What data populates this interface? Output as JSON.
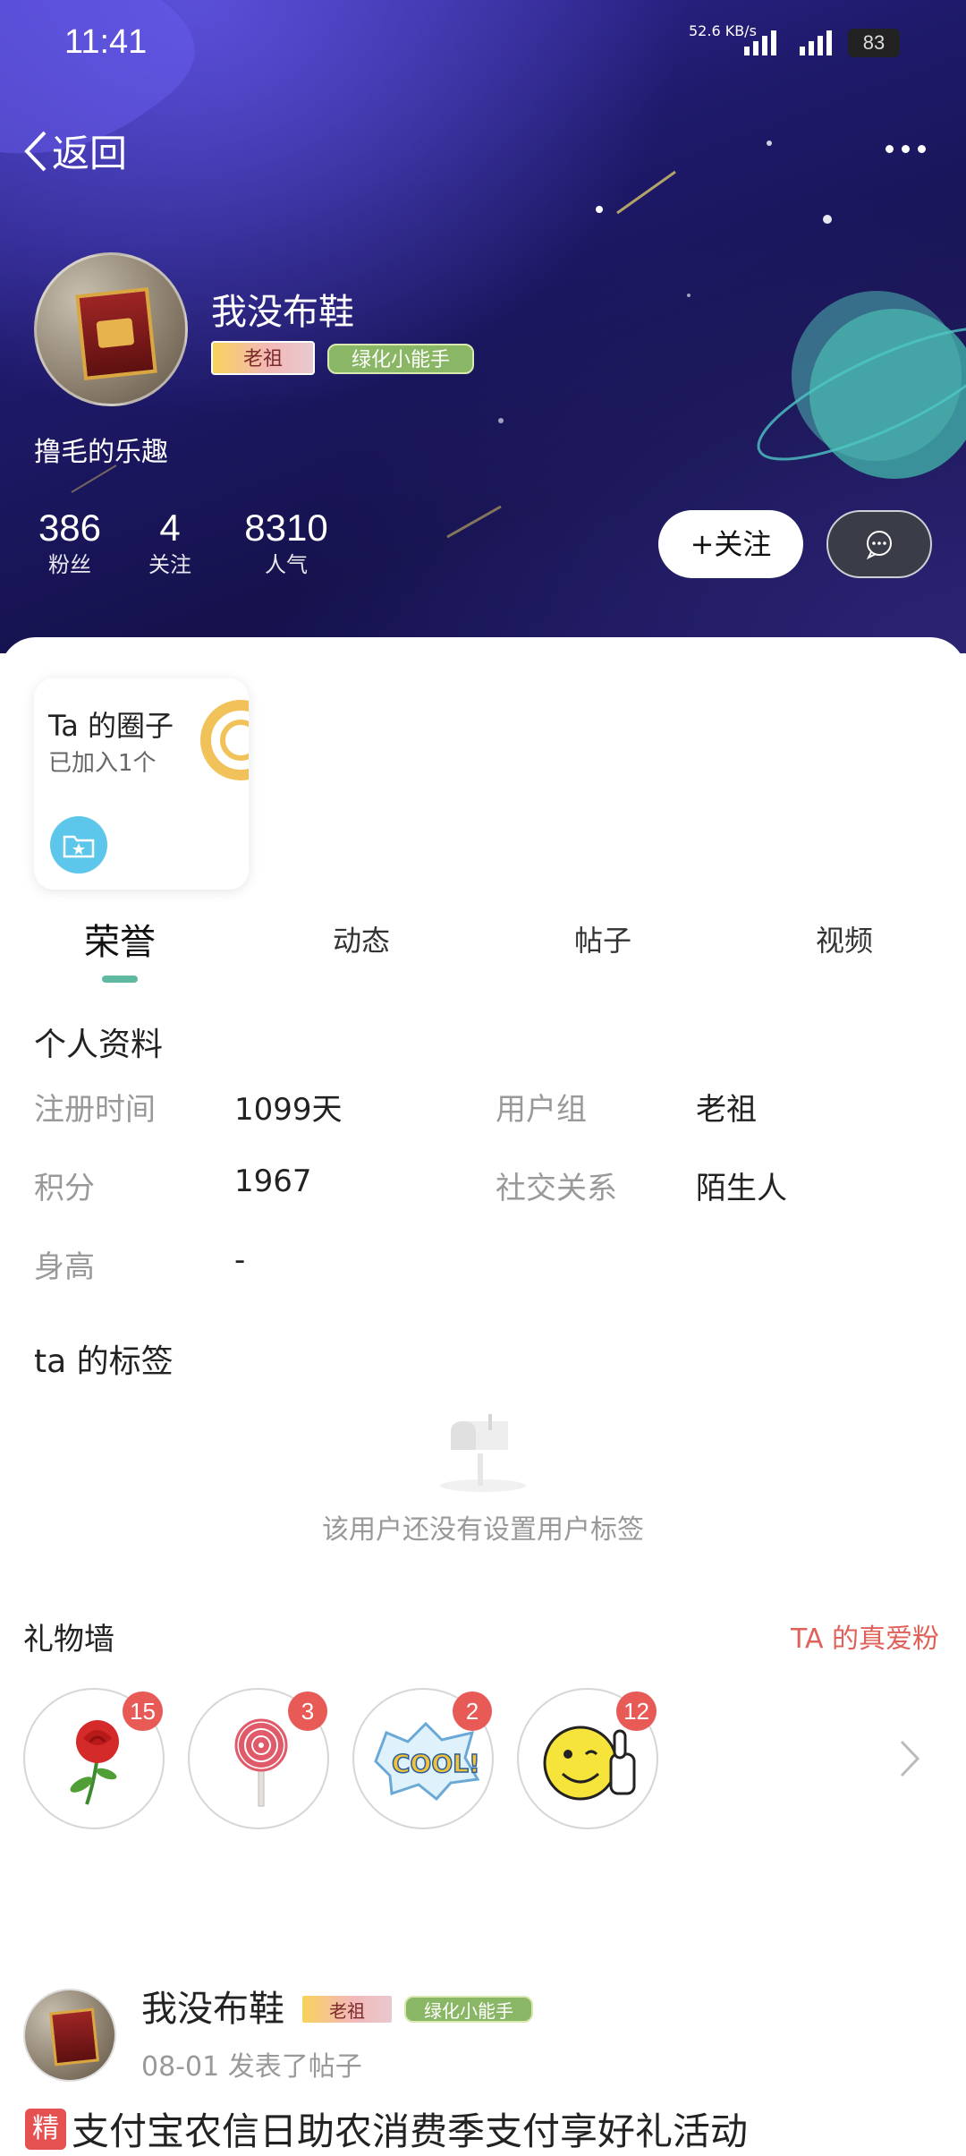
{
  "status_bar": {
    "time": "11:41",
    "net_speed": "52.6 KB/s",
    "network": "5G",
    "battery": "83"
  },
  "header": {
    "back_label": "返回"
  },
  "profile": {
    "username": "我没布鞋",
    "badges": [
      "老祖",
      "绿化小能手"
    ],
    "bio": "撸毛的乐趣",
    "stats": [
      {
        "value": "386",
        "label": "粉丝"
      },
      {
        "value": "4",
        "label": "关注"
      },
      {
        "value": "8310",
        "label": "人气"
      }
    ],
    "follow_label": "+关注"
  },
  "circle_card": {
    "title": "Ta 的圈子",
    "subtitle": "已加入1个"
  },
  "tabs": [
    {
      "label": "荣誉",
      "active": true
    },
    {
      "label": "动态",
      "active": false
    },
    {
      "label": "帖子",
      "active": false
    },
    {
      "label": "视频",
      "active": false
    }
  ],
  "personal_info": {
    "title": "个人资料",
    "rows": [
      {
        "label": "注册时间",
        "value": "1099天"
      },
      {
        "label": "用户组",
        "value": "老祖"
      },
      {
        "label": "积分",
        "value": "1967"
      },
      {
        "label": "社交关系",
        "value": "陌生人"
      },
      {
        "label": "身高",
        "value": "-"
      }
    ]
  },
  "tags_section": {
    "title": "ta 的标签",
    "empty_text": "该用户还没有设置用户标签"
  },
  "gift_wall": {
    "title": "礼物墙",
    "link": "TA 的真爱粉",
    "gifts": [
      {
        "name": "rose-icon",
        "count": "15"
      },
      {
        "name": "lollipop-icon",
        "count": "3"
      },
      {
        "name": "cool-sticker-icon",
        "count": "2"
      },
      {
        "name": "thumbs-up-smiley-icon",
        "count": "12"
      }
    ]
  },
  "post": {
    "author": "我没布鞋",
    "badges": [
      "老祖",
      "绿化小能手"
    ],
    "meta": "08-01 发表了帖子",
    "tag": "精",
    "title": "支付宝农信日助农消费季支付享好礼活动"
  },
  "colors": {
    "accent_green": "#5fb9a0",
    "gift_badge": "#e85a56",
    "link_red": "#e0605a"
  }
}
